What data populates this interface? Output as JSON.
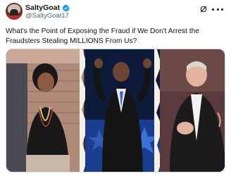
{
  "author": {
    "display_name": "SaltyGoat",
    "handle": "@SaltyGoat17",
    "verified": true
  },
  "tweet": {
    "text": "What's the Point of Exposing the Fraud if We Don't Arrest the Fraudsters Stealing MILLIONS From Us?"
  },
  "icons": {
    "avatar": "user-avatar",
    "verified": "verified-badge-icon",
    "grok": "grok-icon",
    "more": "more-options-icon"
  },
  "colors": {
    "verified_blue": "#1d9bf0",
    "text_primary": "#0f1419",
    "text_secondary": "#536471"
  },
  "media": {
    "description_hidden": true,
    "panels": 3
  }
}
